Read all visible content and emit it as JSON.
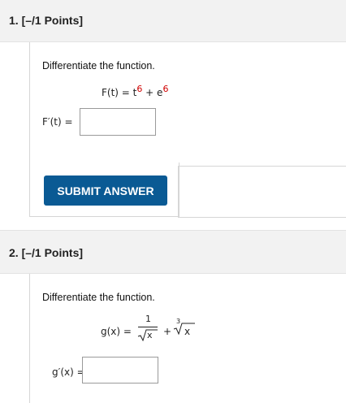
{
  "q1": {
    "header": "1.  [–/1 Points]",
    "prompt": "Differentiate the function.",
    "eq_lhs": "F(t) = t",
    "eq_exp1": "6",
    "eq_mid": " + e",
    "eq_exp2": "6",
    "answer_label": "F′(t) =",
    "answer_value": "",
    "submit_label": "SUBMIT ANSWER"
  },
  "q2": {
    "header": "2.  [–/1 Points]",
    "prompt": "Differentiate the function.",
    "eq_lhs": "g(x) =",
    "frac_num": "1",
    "frac_den": "x",
    "plus": "+",
    "cube_index": "3",
    "cube_radicand": "x",
    "answer_label": "g′(x) =",
    "answer_value": ""
  }
}
